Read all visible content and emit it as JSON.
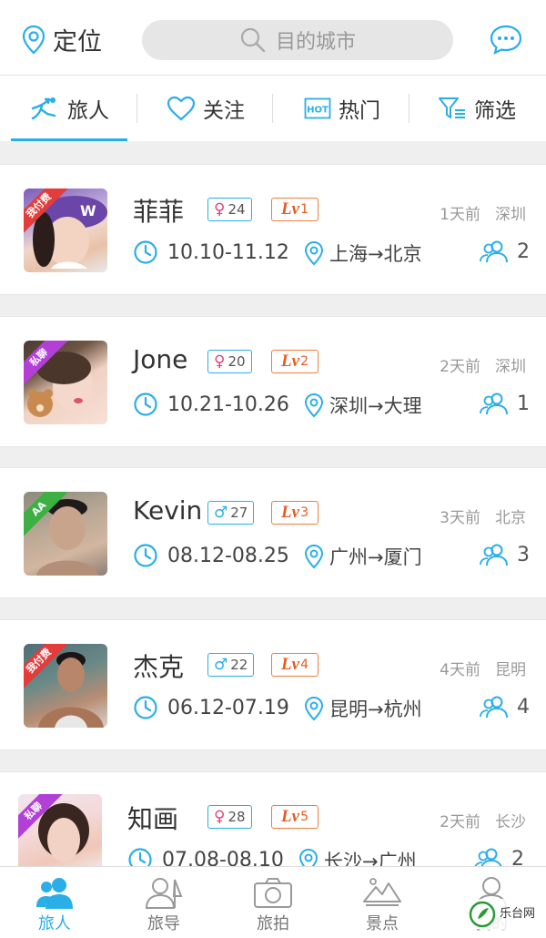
{
  "header": {
    "location_label": "定位",
    "search_placeholder": "目的城市"
  },
  "tabs": [
    {
      "label": "旅人",
      "icon": "traveler-icon",
      "active": true
    },
    {
      "label": "关注",
      "icon": "heart-icon"
    },
    {
      "label": "热门",
      "icon": "hot-icon"
    },
    {
      "label": "筛选",
      "icon": "filter-icon"
    }
  ],
  "colors": {
    "accent": "#2aaee8",
    "level": "#e85a20",
    "ribbon_red": "#e43b3b",
    "ribbon_purple": "#b23fd6",
    "ribbon_green": "#3cb043"
  },
  "cards": [
    {
      "ribbon": "我付费",
      "name": "菲菲",
      "gender": "♀",
      "age": "24",
      "level": "1",
      "time": "1天前",
      "city": "深圳",
      "dates": "10.10-11.12",
      "route": "上海→北京",
      "count": "2"
    },
    {
      "ribbon": "私聊",
      "name": "Jone",
      "gender": "♀",
      "age": "20",
      "level": "2",
      "time": "2天前",
      "city": "深圳",
      "dates": "10.21-10.26",
      "route": "深圳→大理",
      "count": "1"
    },
    {
      "ribbon": "AA",
      "name": "Kevin",
      "gender": "♂",
      "age": "27",
      "level": "3",
      "time": "3天前",
      "city": "北京",
      "dates": "08.12-08.25",
      "route": "广州→厦门",
      "count": "3"
    },
    {
      "ribbon": "我付费",
      "name": "杰克",
      "gender": "♂",
      "age": "22",
      "level": "4",
      "time": "4天前",
      "city": "昆明",
      "dates": "06.12-07.19",
      "route": "昆明→杭州",
      "count": "4"
    },
    {
      "ribbon": "私聊",
      "name": "知画",
      "gender": "♀",
      "age": "28",
      "level": "5",
      "time": "2天前",
      "city": "长沙",
      "dates": "07.08-08.10",
      "route": "长沙→广州",
      "count": "2"
    }
  ],
  "level_prefix": "Lv",
  "bottom_nav": [
    {
      "label": "旅人",
      "icon": "travelers-icon",
      "active": true
    },
    {
      "label": "旅导",
      "icon": "guide-icon"
    },
    {
      "label": "旅拍",
      "icon": "camera-icon"
    },
    {
      "label": "景点",
      "icon": "landscape-icon"
    },
    {
      "label": "我的",
      "icon": "profile-icon"
    }
  ],
  "watermark": {
    "text": "乐台网"
  }
}
